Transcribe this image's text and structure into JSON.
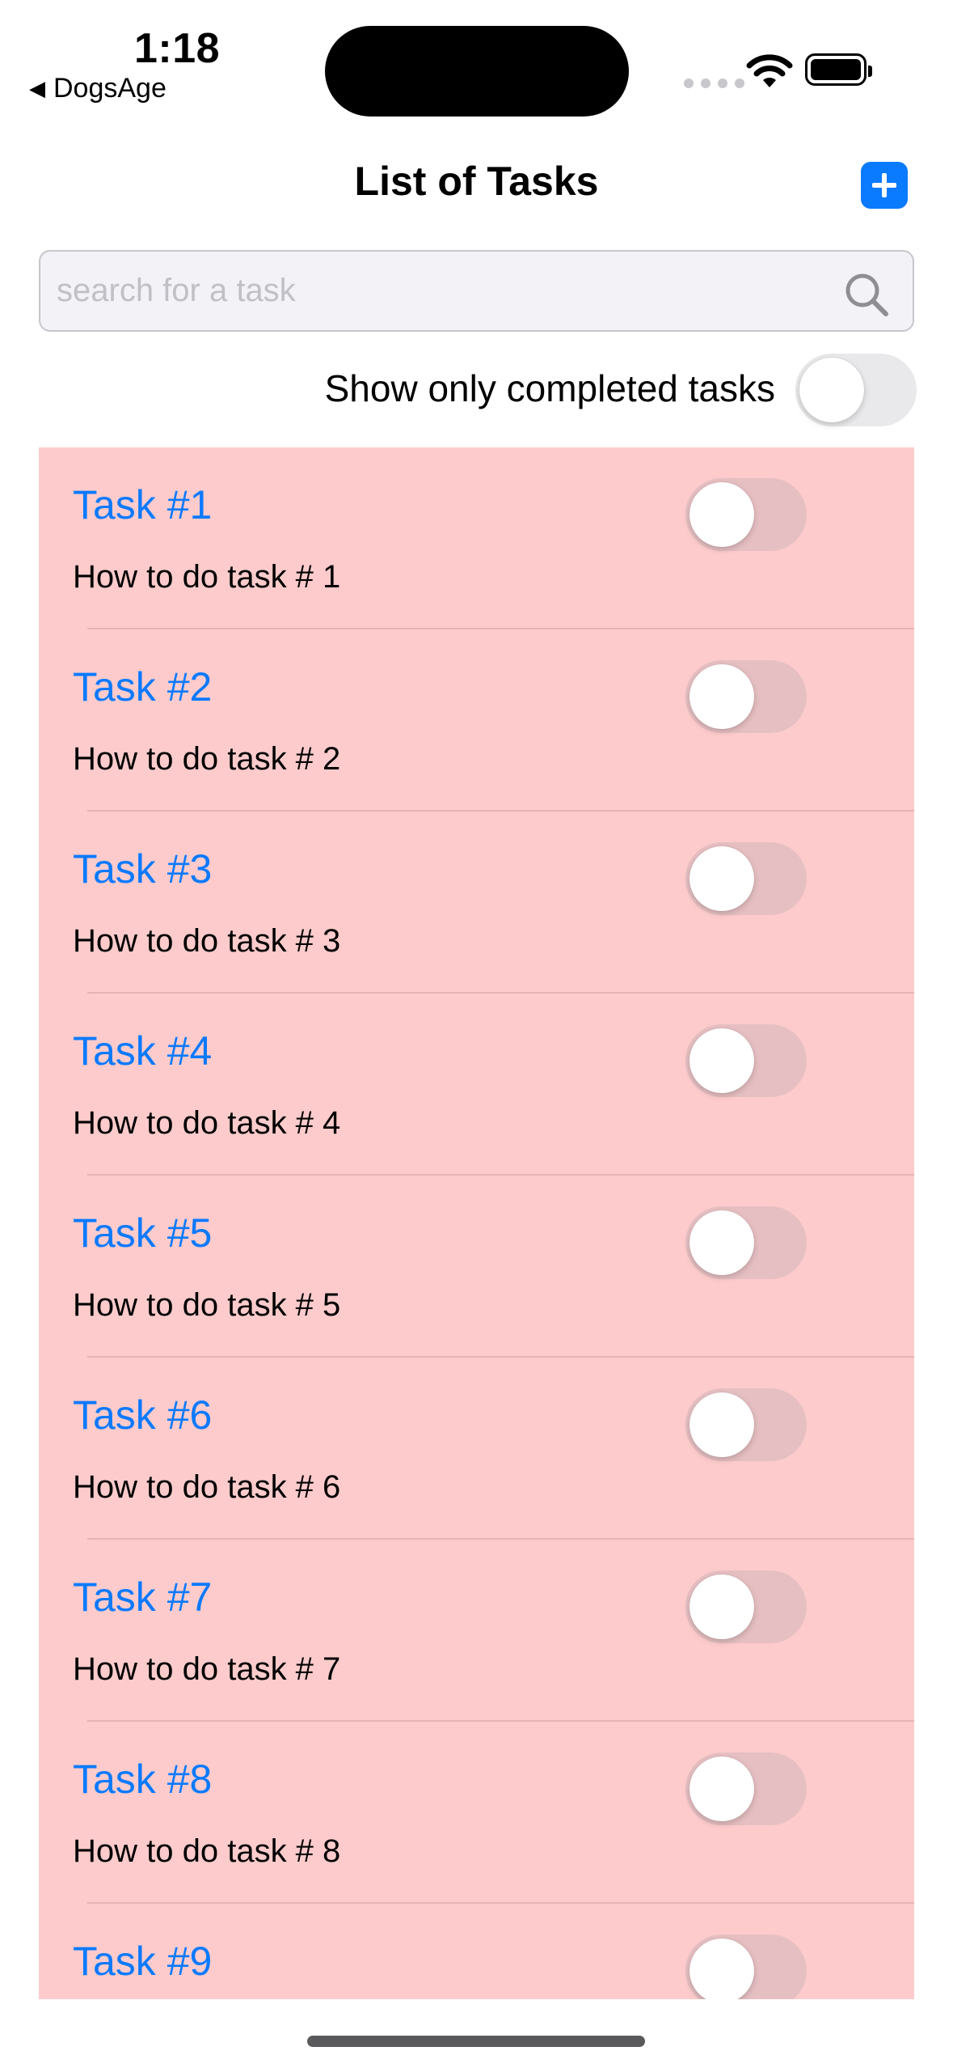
{
  "status_bar": {
    "time": "1:18",
    "back_app": "DogsAge",
    "back_icon": "back-triangle-icon"
  },
  "nav": {
    "title": "List of Tasks",
    "add_icon": "plus-icon"
  },
  "search": {
    "placeholder": "search for a task",
    "value": ""
  },
  "filter": {
    "label": "Show only completed tasks",
    "on": false
  },
  "colors": {
    "accent": "#0a7aff",
    "row_background": "#fdcbcb"
  },
  "tasks": [
    {
      "title": "Task #1",
      "description": "How to do task # 1",
      "completed": false
    },
    {
      "title": "Task #2",
      "description": "How to do task # 2",
      "completed": false
    },
    {
      "title": "Task #3",
      "description": "How to do task # 3",
      "completed": false
    },
    {
      "title": "Task #4",
      "description": "How to do task # 4",
      "completed": false
    },
    {
      "title": "Task #5",
      "description": "How to do task # 5",
      "completed": false
    },
    {
      "title": "Task #6",
      "description": "How to do task # 6",
      "completed": false
    },
    {
      "title": "Task #7",
      "description": "How to do task # 7",
      "completed": false
    },
    {
      "title": "Task #8",
      "description": "How to do task # 8",
      "completed": false
    },
    {
      "title": "Task #9",
      "description": "",
      "completed": false
    }
  ]
}
